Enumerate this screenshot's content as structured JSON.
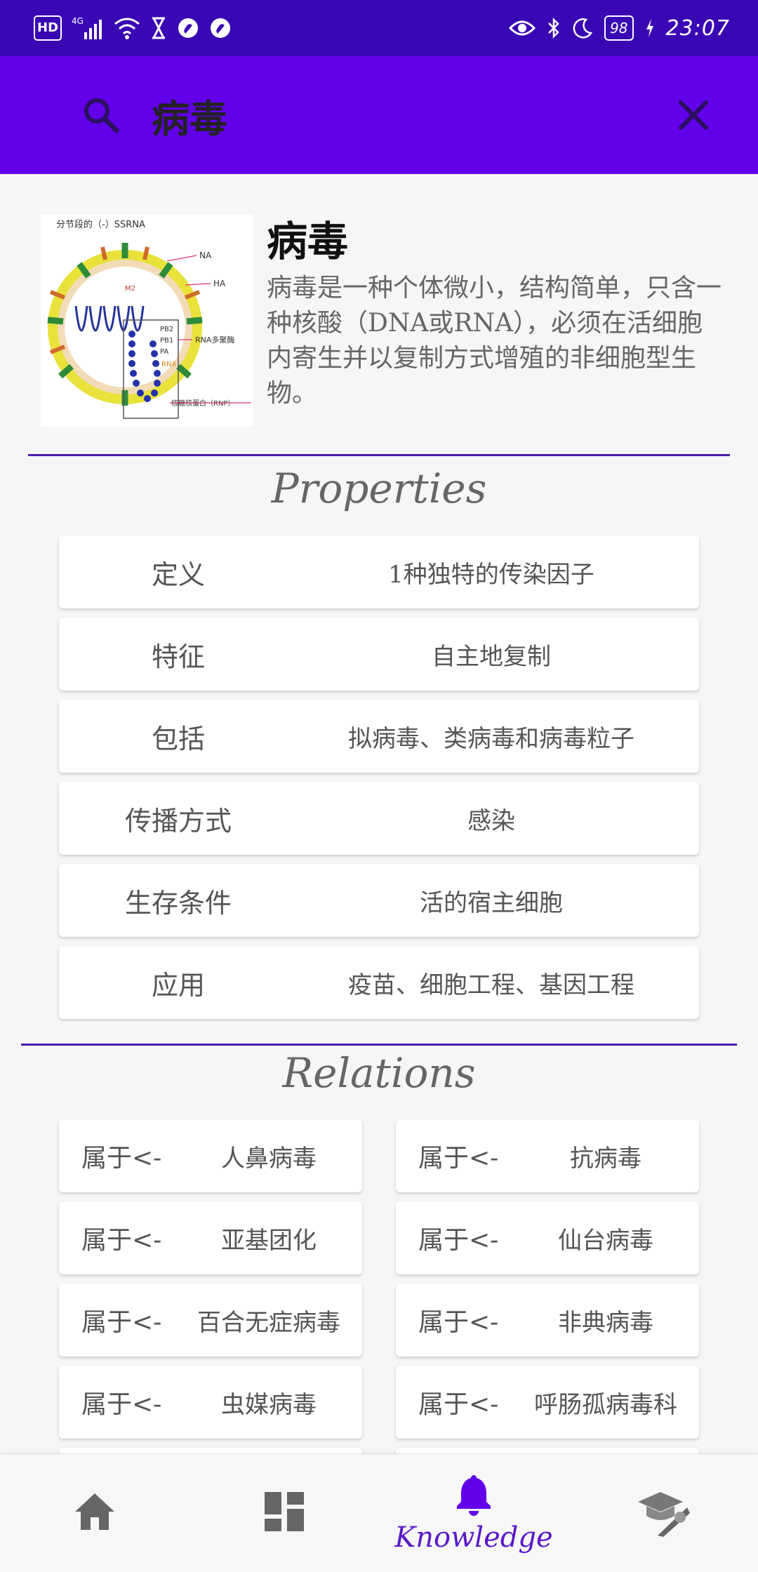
{
  "status_bar": {
    "left_badge": "HD",
    "network": "4G",
    "battery": "98",
    "time": "23:07"
  },
  "search": {
    "query": "病毒"
  },
  "entity": {
    "title": "病毒",
    "description": "病毒是一种个体微小，结构简单，只含一种核酸（DNA或RNA），必须在活细胞内寄生并以复制方式增殖的非细胞型生物。",
    "image_labels": {
      "top": "分节段的（-）SSRNA",
      "na": "NA",
      "ha": "HA",
      "m2": "M2",
      "pb2": "PB2",
      "pb1": "PB1",
      "pa": "PA",
      "polymerase": "RNA多聚酶",
      "rna": "RNA",
      "rnp": "核糖核蛋白（RNP）"
    }
  },
  "properties_title": "Properties",
  "properties": [
    {
      "key": "定义",
      "value": "1种独特的传染因子"
    },
    {
      "key": "特征",
      "value": "自主地复制"
    },
    {
      "key": "包括",
      "value": "拟病毒、类病毒和病毒粒子"
    },
    {
      "key": "传播方式",
      "value": "感染"
    },
    {
      "key": "生存条件",
      "value": "活的宿主细胞"
    },
    {
      "key": "应用",
      "value": "疫苗、细胞工程、基因工程"
    }
  ],
  "relations_title": "Relations",
  "relations": [
    {
      "type": "属于<-",
      "target": "人鼻病毒"
    },
    {
      "type": "属于<-",
      "target": "抗病毒"
    },
    {
      "type": "属于<-",
      "target": "亚基团化"
    },
    {
      "type": "属于<-",
      "target": "仙台病毒"
    },
    {
      "type": "属于<-",
      "target": "百合无症病毒"
    },
    {
      "type": "属于<-",
      "target": "非典病毒"
    },
    {
      "type": "属于<-",
      "target": "虫媒病毒"
    },
    {
      "type": "属于<-",
      "target": "呼肠孤病毒科"
    }
  ],
  "nav": {
    "active_label": "Knowledge",
    "items": [
      "home-icon",
      "dashboard-icon",
      "bell-icon",
      "graduation-icon"
    ]
  },
  "colors": {
    "status_bar": "#3a07b4",
    "header": "#6200ea",
    "accent": "#5b19c9"
  }
}
